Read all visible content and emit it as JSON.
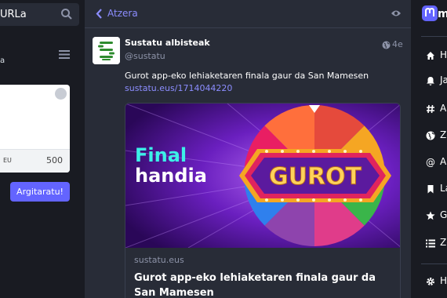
{
  "left": {
    "search_text": "URLa",
    "small_text": "a",
    "compose": {
      "lang": "EU",
      "char_counter": "500",
      "publish_label": "Argitaratu!"
    }
  },
  "header": {
    "back_label": "Atzera"
  },
  "status": {
    "display_name": "Sustatu albisteak",
    "handle": "@sustatu",
    "time": "4e",
    "content": "Gurot app-eko lehiaketaren finala gaur da San Mamesen",
    "link": "sustatu.eus/1714044220",
    "card": {
      "domain": "sustatu.eus",
      "title": "Gurot app-eko lehiaketaren finala gaur da San Mamesen",
      "image_text_1": "Final",
      "image_text_2": "handia",
      "image_logo": "GUROT"
    }
  },
  "right_nav": {
    "logo_text": "ma",
    "items": [
      {
        "label": "H",
        "icon": "home-icon"
      },
      {
        "label": "Ja",
        "icon": "bell-icon"
      },
      {
        "label": "Ar",
        "icon": "hashtag-icon"
      },
      {
        "label": "Ze",
        "icon": "globe-icon"
      },
      {
        "label": "Ai",
        "icon": "at-icon"
      },
      {
        "label": "La",
        "icon": "bookmark-icon"
      },
      {
        "label": "Go",
        "icon": "star-icon"
      },
      {
        "label": "Ze",
        "icon": "list-icon"
      },
      {
        "label": "H",
        "icon": "gear-icon"
      }
    ]
  },
  "colors": {
    "accent": "#6364ff",
    "link": "#8c8dff",
    "background": "#191b22",
    "column": "#282c37"
  }
}
